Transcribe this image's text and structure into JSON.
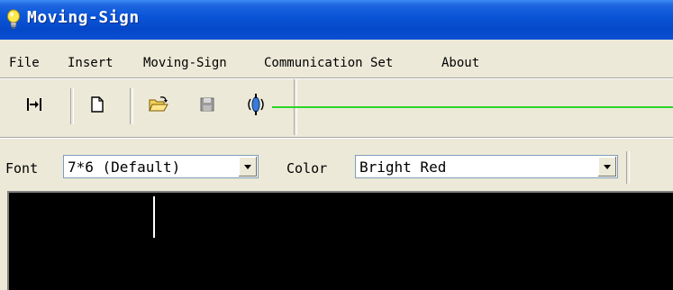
{
  "window": {
    "title": "Moving-Sign"
  },
  "menu": [
    "File",
    "Insert",
    "Moving-Sign",
    "Communication Set",
    "About"
  ],
  "toolbar": {
    "buttons": [
      {
        "name": "fit-width-icon"
      },
      {
        "name": "new-document-icon"
      },
      {
        "name": "open-folder-icon"
      },
      {
        "name": "save-disk-icon"
      },
      {
        "name": "transmit-icon"
      }
    ]
  },
  "font_bar": {
    "font_label": "Font",
    "font_value": "7*6 (Default)",
    "color_label": "Color",
    "color_value": "Bright Red"
  },
  "colors": {
    "title_bar": "#0a55d8",
    "progress_line": "#2bd62b",
    "canvas": "#000000"
  }
}
